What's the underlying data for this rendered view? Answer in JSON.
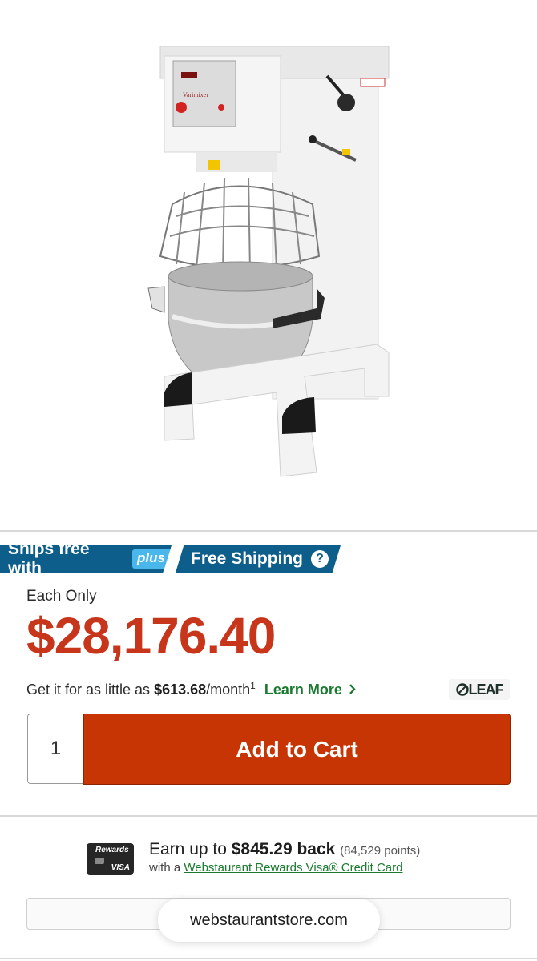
{
  "product": {
    "image_alt": "Varimixer commercial planetary mixer",
    "panel_brand": "Varimixer"
  },
  "shipping": {
    "ships_free_label": "Ships free with",
    "plus_label": "plus",
    "free_shipping_label": "Free Shipping",
    "help_symbol": "?"
  },
  "pricing": {
    "each_label": "Each Only",
    "price": "$28,176.40",
    "finance_prefix": "Get it for as little as ",
    "finance_amount": "$613.68",
    "finance_suffix": "/month",
    "finance_footnote": "1",
    "learn_more_label": "Learn More",
    "leaf_logo": "LEAF"
  },
  "cart": {
    "quantity": "1",
    "add_to_cart_label": "Add to Cart"
  },
  "rewards": {
    "card_brand": "Rewards",
    "card_network": "VISA",
    "earn_prefix": "Earn up to ",
    "earn_amount": "$845.29 back",
    "points": "(84,529 points)",
    "with_label": "with a ",
    "card_link": "Webstaurant Rewards Visa® Credit Card"
  },
  "browser": {
    "url": "webstaurantstore.com"
  },
  "colors": {
    "price_red": "#c7361a",
    "cart_orange": "#c73504",
    "badge_blue": "#0d5e8a",
    "link_green": "#1a7a30"
  },
  "icons": {
    "help": "question-circle-icon",
    "learn_more": "chevron-right-icon"
  }
}
